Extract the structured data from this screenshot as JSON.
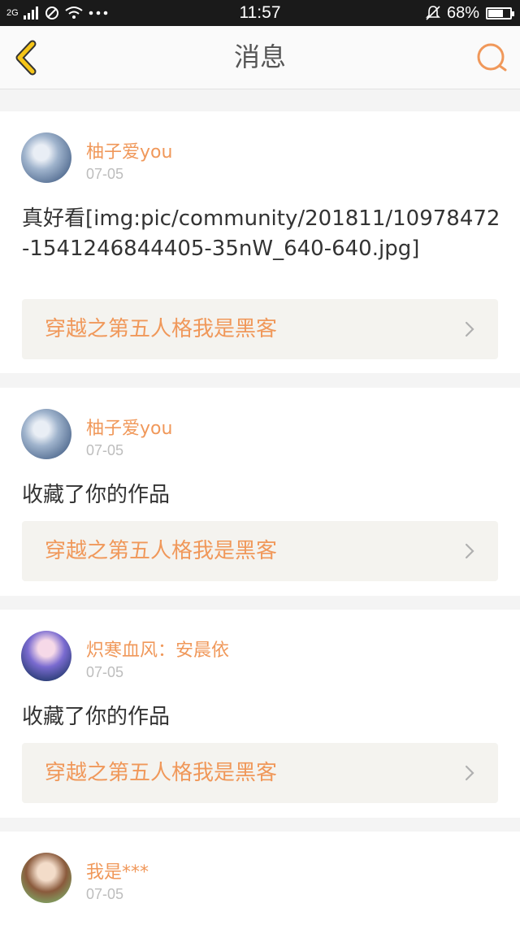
{
  "status_bar": {
    "network": "2G",
    "time": "11:57",
    "battery_percent": "68%",
    "battery_level": 0.68
  },
  "header": {
    "title": "消息"
  },
  "messages": [
    {
      "username": "柚子爱you",
      "date": "07-05",
      "content": "真好看[img:pic/community/201811/10978472-1541246844405-35nW_640-640.jpg]",
      "work_title": "穿越之第五人格我是黑客"
    },
    {
      "username": "柚子爱you",
      "date": "07-05",
      "content": "收藏了你的作品",
      "work_title": "穿越之第五人格我是黑客"
    },
    {
      "username": "炽寒血风：安晨依",
      "date": "07-05",
      "content": "收藏了你的作品",
      "work_title": "穿越之第五人格我是黑客"
    },
    {
      "username": "我是***",
      "date": "07-05"
    }
  ],
  "colors": {
    "accent": "#f0985a",
    "back_arrow": "#f5c518"
  }
}
